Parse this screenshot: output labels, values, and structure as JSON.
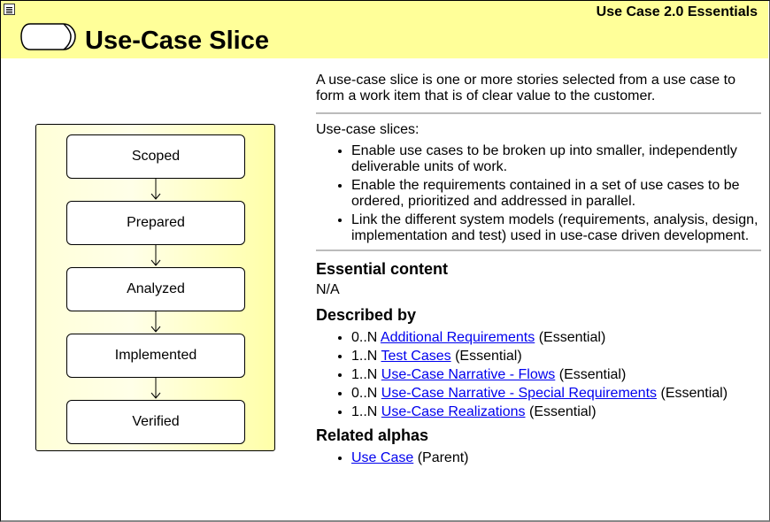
{
  "header": {
    "suite_title": "Use Case 2.0 Essentials",
    "page_title": "Use-Case Slice"
  },
  "states": [
    "Scoped",
    "Prepared",
    "Analyzed",
    "Implemented",
    "Verified"
  ],
  "content": {
    "intro": "A use-case slice is one or more stories selected from a use case to form a work item that is of clear value to the customer.",
    "slices_label": "Use-case slices:",
    "slice_points": [
      "Enable use cases to be broken up into smaller, independently deliverable units of work.",
      "Enable the requirements contained in a set of use cases to be ordered, prioritized and addressed in parallel.",
      "Link the different system models (requirements, analysis, design, implementation and test) used in use-case driven development."
    ],
    "essential_heading": "Essential content",
    "essential_value": "N/A",
    "described_heading": "Described by",
    "described_by": [
      {
        "mult": "0..N",
        "link": "Additional Requirements",
        "note": "(Essential)"
      },
      {
        "mult": "1..N",
        "link": "Test Cases",
        "note": "(Essential)"
      },
      {
        "mult": "1..N",
        "link": "Use-Case Narrative - Flows",
        "note": "(Essential)"
      },
      {
        "mult": "0..N",
        "link": "Use-Case Narrative - Special Requirements",
        "note": "(Essential)"
      },
      {
        "mult": "1..N",
        "link": "Use-Case Realizations",
        "note": "(Essential)"
      }
    ],
    "related_heading": "Related alphas",
    "related_alphas": [
      {
        "link": "Use Case",
        "note": "(Parent)"
      }
    ]
  },
  "colors": {
    "header_bg": "#ffff99",
    "link": "#0000ee"
  },
  "icons": {
    "menu": "menu-icon",
    "alpha": "alpha-shape-icon"
  }
}
